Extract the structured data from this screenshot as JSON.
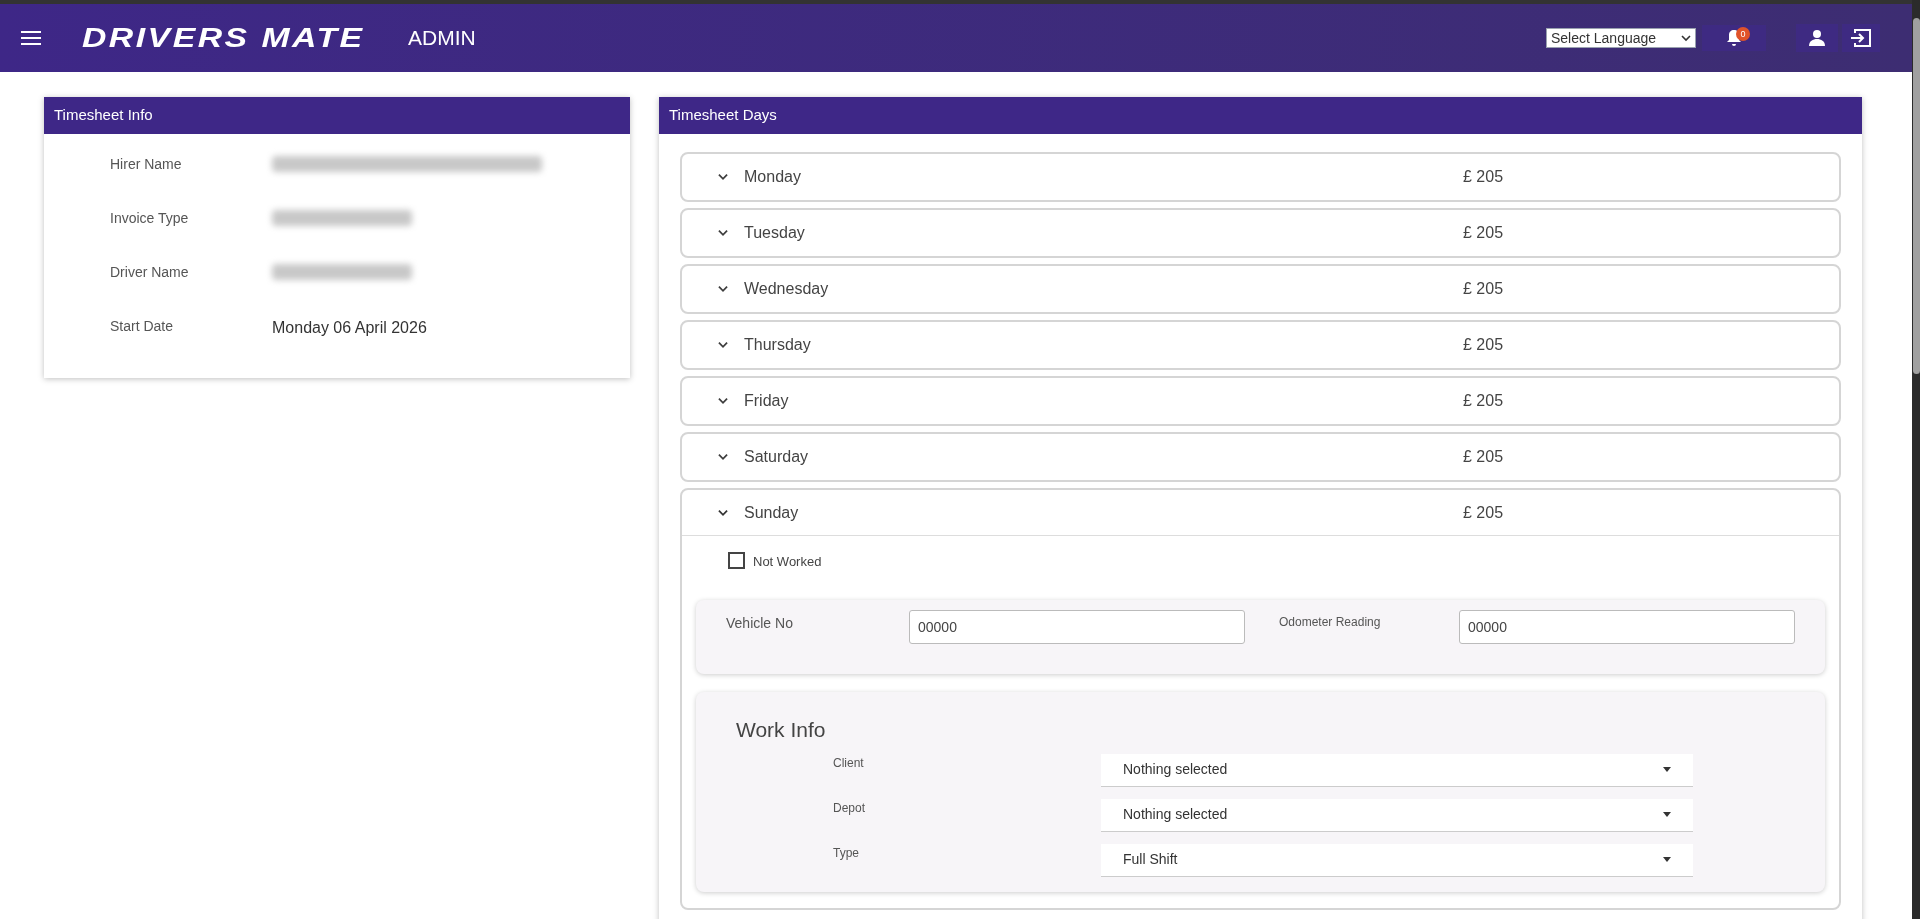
{
  "header": {
    "logo": "DRIVERS MATE",
    "title": "ADMIN",
    "language_select": "Select Language",
    "notification_count": "0"
  },
  "timesheet_info": {
    "title": "Timesheet Info",
    "fields": [
      {
        "label": "Hirer Name",
        "kind": "blurred"
      },
      {
        "label": "Invoice Type",
        "kind": "blurred"
      },
      {
        "label": "Driver Name",
        "kind": "blurred"
      },
      {
        "label": "Start Date",
        "kind": "text",
        "value": "Monday 06 April 2026"
      }
    ]
  },
  "timesheet_days": {
    "title": "Timesheet Days",
    "days": [
      {
        "day": "Monday",
        "amount": "£ 205",
        "expanded": false
      },
      {
        "day": "Tuesday",
        "amount": "£ 205",
        "expanded": false
      },
      {
        "day": "Wednesday",
        "amount": "£ 205",
        "expanded": false
      },
      {
        "day": "Thursday",
        "amount": "£ 205",
        "expanded": false
      },
      {
        "day": "Friday",
        "amount": "£ 205",
        "expanded": false
      },
      {
        "day": "Saturday",
        "amount": "£ 205",
        "expanded": false
      },
      {
        "day": "Sunday",
        "amount": "£ 205",
        "expanded": true
      }
    ],
    "not_worked": {
      "label": "Not Worked",
      "checked": false
    },
    "vehicle": {
      "vehicle_no": {
        "label": "Vehicle No",
        "value": "00000"
      },
      "odometer": {
        "label": "Odometer Reading",
        "value": "00000"
      }
    },
    "work_info": {
      "title": "Work Info",
      "fields": [
        {
          "label": "Client",
          "value": "Nothing selected"
        },
        {
          "label": "Depot",
          "value": "Nothing selected"
        },
        {
          "label": "Type",
          "value": "Full Shift"
        }
      ]
    }
  }
}
